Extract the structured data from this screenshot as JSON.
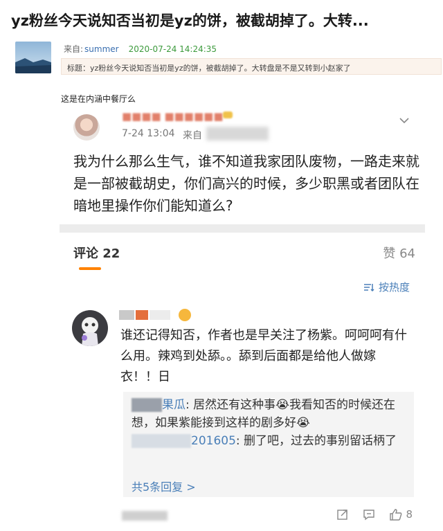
{
  "page": {
    "title": "yz粉丝今天说知否当初是yz的饼，被截胡掉了。大转..."
  },
  "post": {
    "from_label": "来自:",
    "from_user": "summer",
    "timestamp": "2020-07-24 14:24:35",
    "subject": "标题：yz粉丝今天说知否当初是yz的饼，被截胡掉了。大转盘是不是又转到小赵家了"
  },
  "caption": "这是在内涵中餐厅么",
  "screenshot": {
    "original_post": {
      "time": "7-24 13:04",
      "source_label": "来自",
      "text": "我为什么那么生气，谁不知道我家团队废物，一路走来就是一部被截胡史，你们高兴的时候，多少职黑或者团队在暗地里操作你们能知道么?"
    },
    "tabs": {
      "comments_label": "评论 22",
      "likes_label": "赞 64"
    },
    "sort_label": "按热度",
    "comment": {
      "text": "谁还记得知否，作者也是早关注了杨紫。呵呵呵有什么用。辣鸡到处舔。。舔到后面都是给他人做嫁衣！！日",
      "replies": [
        {
          "name_visible": "果瓜",
          "text": "居然还有这种事😭我看知否的时候还在想，如果紫能接到这样的剧多好😭"
        },
        {
          "name_visible": "201605",
          "text": "删了吧，过去的事别留话柄了"
        }
      ],
      "more_replies_label": "共5条回复 >",
      "like_count": "8"
    }
  },
  "colors": {
    "link_blue": "#4a7fb8",
    "time_green": "#3c9a3c",
    "tab_underline_orange": "#ff8200"
  }
}
